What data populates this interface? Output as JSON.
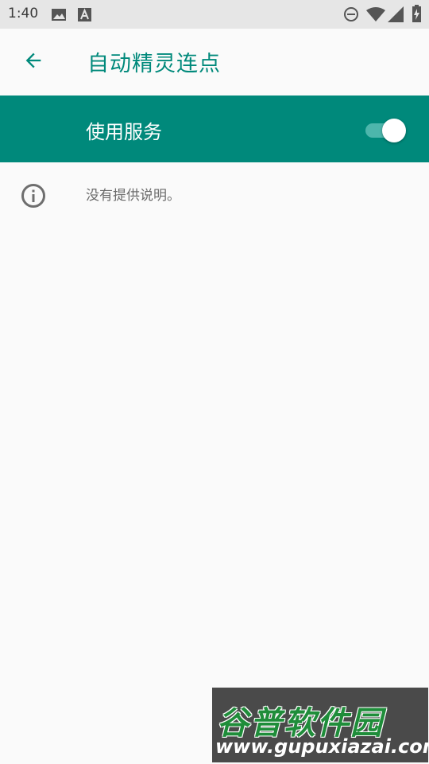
{
  "status_bar": {
    "time": "1:40",
    "icons": [
      "image-icon",
      "a-notification-icon",
      "do-not-disturb-icon",
      "wifi-icon",
      "signal-icon",
      "battery-charging-icon"
    ]
  },
  "app_bar": {
    "title": "自动精灵连点",
    "back_icon": "arrow-back-icon"
  },
  "master_switch": {
    "label": "使用服务",
    "checked": true
  },
  "info": {
    "text": "没有提供说明。",
    "icon": "info-icon"
  },
  "watermark": {
    "brand": "谷普软件园",
    "url": "www.gupuxiazai.com"
  },
  "colors": {
    "accent": "#00897b",
    "toggle_track": "#4db6ac",
    "background": "#fafafa",
    "status_bar": "#e6e6e6"
  }
}
